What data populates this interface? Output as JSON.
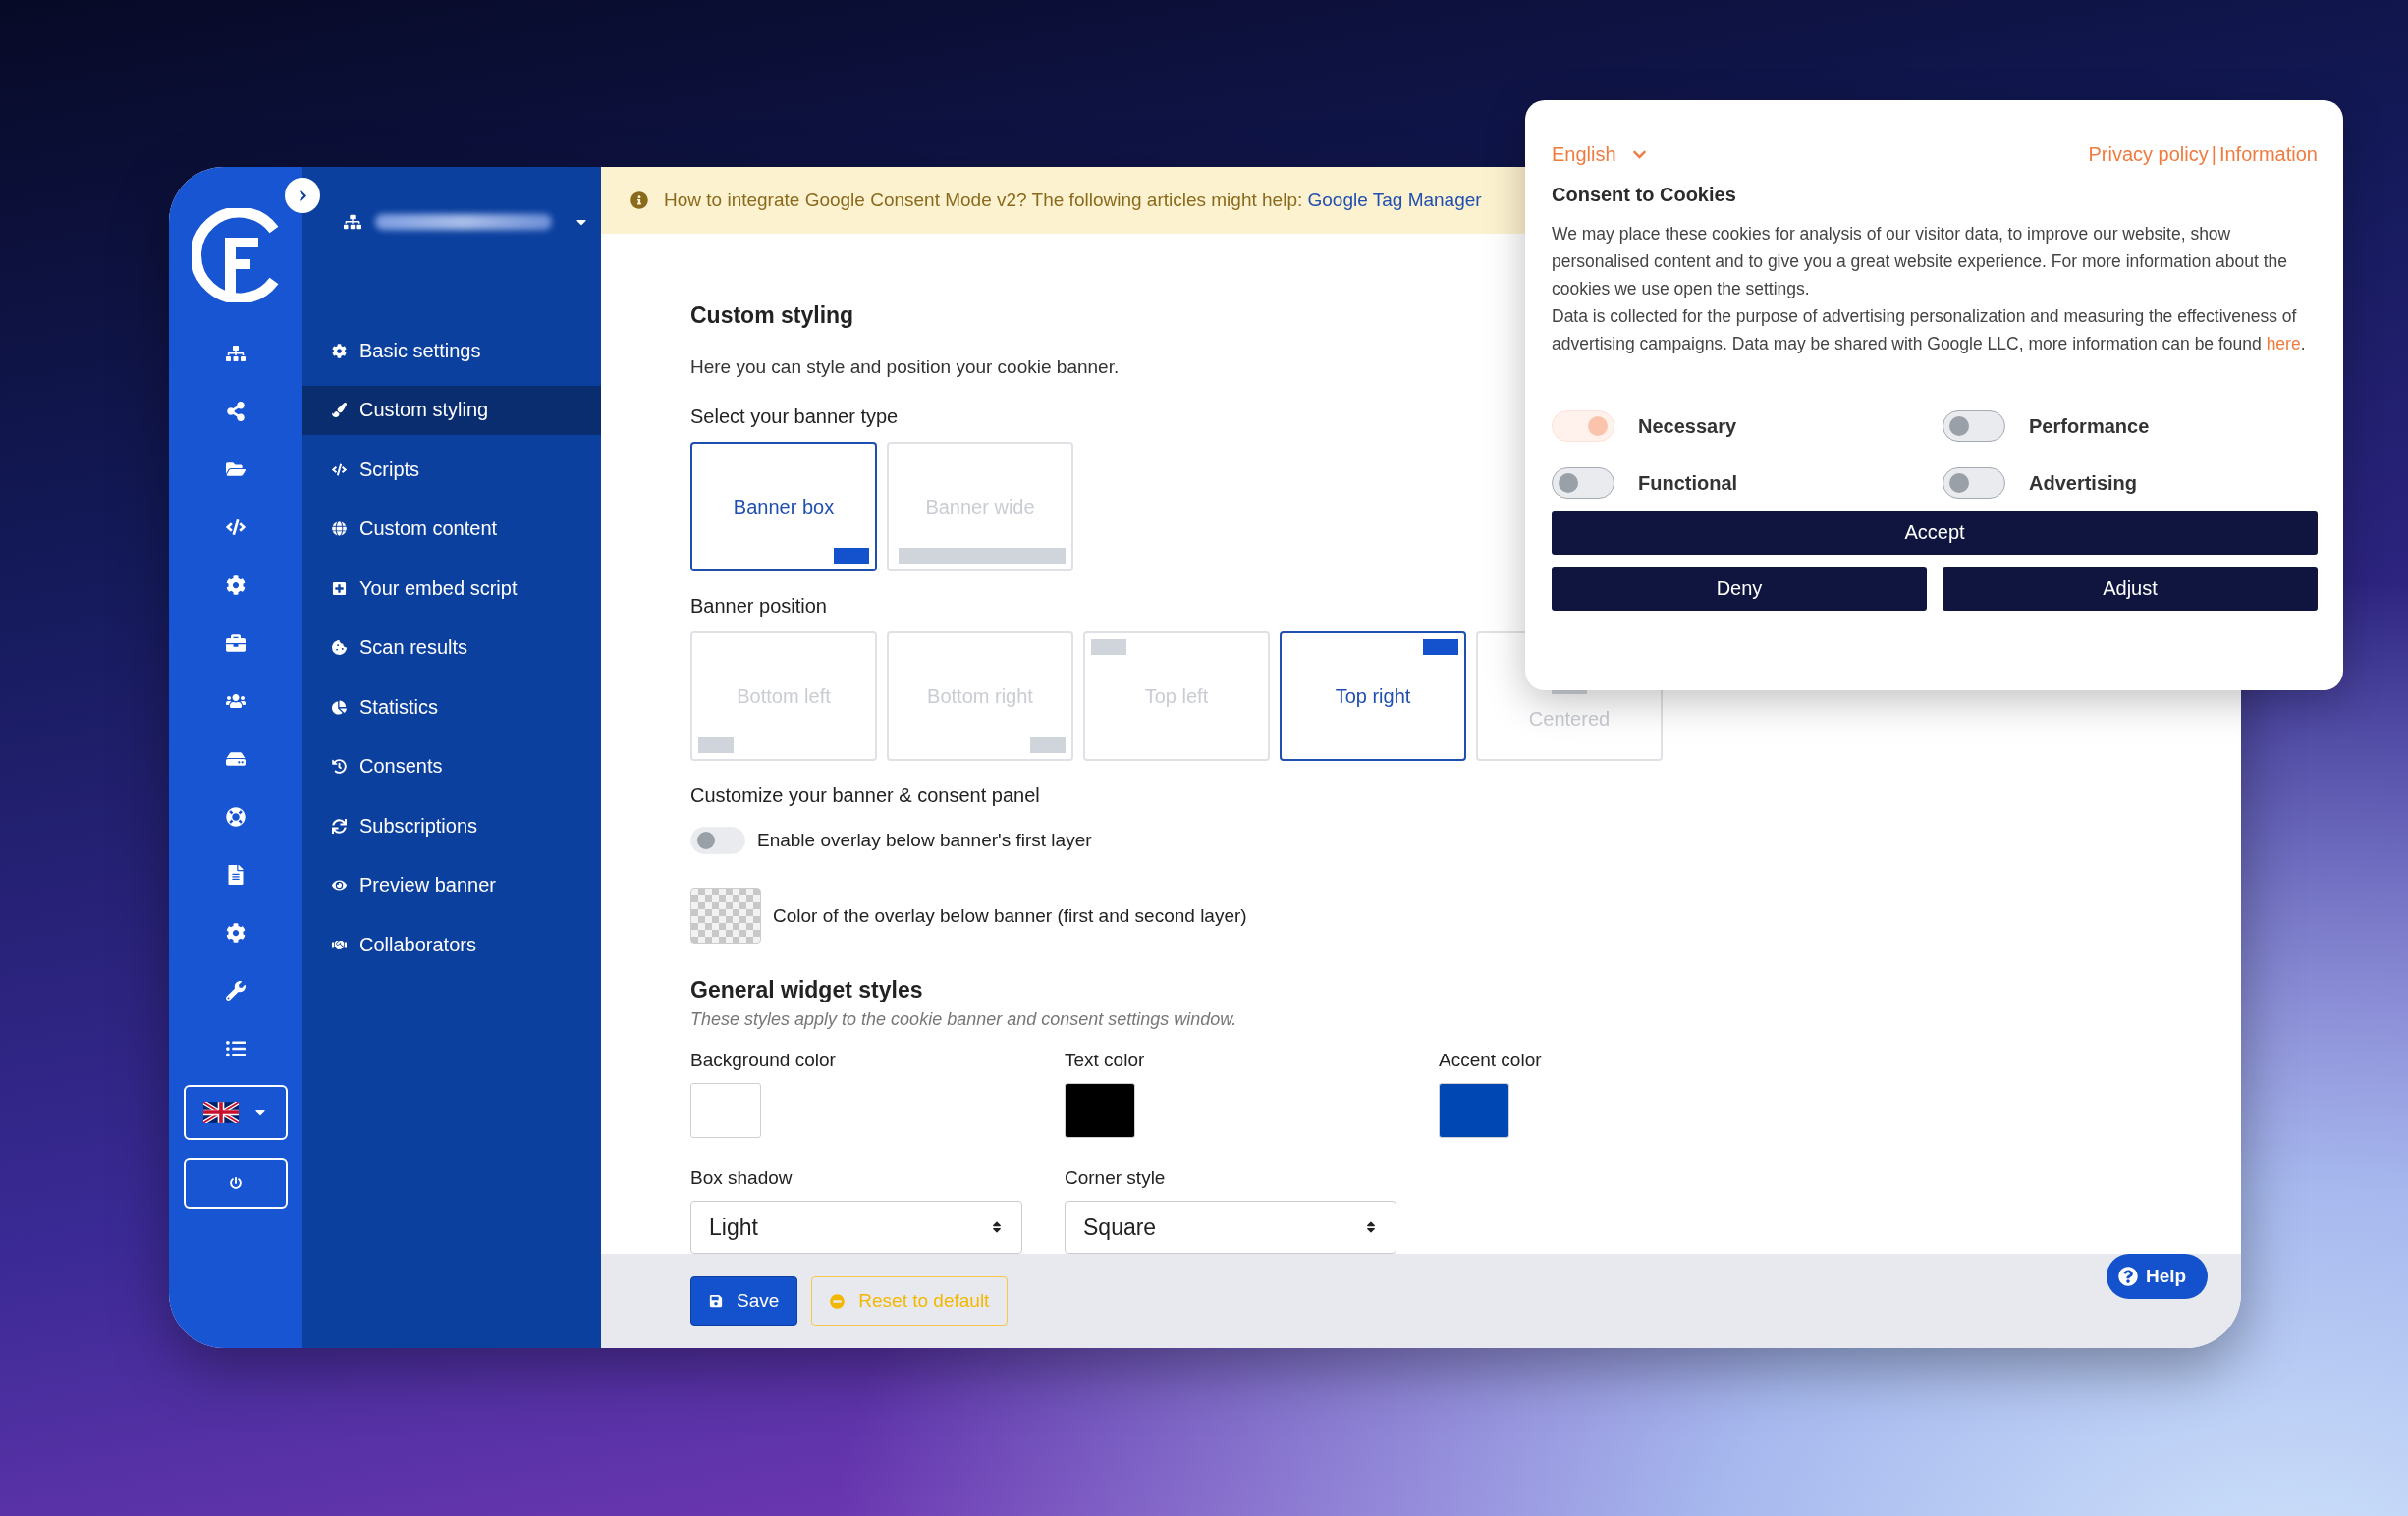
{
  "nav": {
    "items": [
      {
        "label": "Basic settings",
        "selected": false
      },
      {
        "label": "Custom styling",
        "selected": true
      },
      {
        "label": "Scripts",
        "selected": false
      },
      {
        "label": "Custom content",
        "selected": false
      },
      {
        "label": "Your embed script",
        "selected": false
      },
      {
        "label": "Scan results",
        "selected": false
      },
      {
        "label": "Statistics",
        "selected": false
      },
      {
        "label": "Consents",
        "selected": false
      },
      {
        "label": "Subscriptions",
        "selected": false
      },
      {
        "label": "Preview banner",
        "selected": false
      },
      {
        "label": "Collaborators",
        "selected": false
      }
    ]
  },
  "notice": {
    "text": "How to integrate Google Consent Mode v2? The following articles might help:",
    "link": "Google Tag Manager"
  },
  "page": {
    "title": "Custom styling",
    "description": "Here you can style and position your cookie banner."
  },
  "banner_type": {
    "label": "Select your banner type",
    "options": [
      {
        "label": "Banner box",
        "kind": "box",
        "selected": true
      },
      {
        "label": "Banner wide",
        "kind": "wide",
        "selected": false
      }
    ]
  },
  "banner_position": {
    "label": "Banner position",
    "options": [
      {
        "label": "Bottom left",
        "kind": "bottom-left",
        "selected": false
      },
      {
        "label": "Bottom right",
        "kind": "bottom-right",
        "selected": false
      },
      {
        "label": "Top left",
        "kind": "top-left",
        "selected": false
      },
      {
        "label": "Top right",
        "kind": "top-right",
        "selected": true
      },
      {
        "label": "Centered",
        "kind": "centered",
        "selected": false
      }
    ]
  },
  "customize": {
    "label": "Customize your banner & consent panel",
    "overlay_toggle": {
      "label": "Enable overlay below banner's first layer",
      "on": false
    },
    "overlay_color": {
      "label": "Color of the overlay below banner (first and second layer)"
    }
  },
  "widget_styles": {
    "title": "General widget styles",
    "subtitle": "These styles apply to the cookie banner and consent settings window.",
    "colors": [
      {
        "label": "Background color",
        "color": "#ffffff"
      },
      {
        "label": "Text color",
        "color": "#000000"
      },
      {
        "label": "Accent color",
        "color": "#0047b3"
      }
    ],
    "selects": [
      {
        "label": "Box shadow",
        "value": "Light"
      },
      {
        "label": "Corner style",
        "value": "Square"
      }
    ]
  },
  "footer": {
    "save": "Save",
    "reset": "Reset to default"
  },
  "help": "Help",
  "popup": {
    "language": "English",
    "links": [
      "Privacy policy",
      "Information"
    ],
    "separator": "|",
    "title": "Consent to Cookies",
    "paragraph_1": "We may place these cookies for analysis of our visitor data, to improve our website, show personalised content and to give you a great website experience. For more information about the cookies we use open the settings.",
    "paragraph_2": {
      "text": "Data is collected for the purpose of advertising personalization and measuring the effectiveness of advertising campaigns. Data may be shared with Google LLC, more information can be found ",
      "link": "here",
      "end": "."
    },
    "toggles": [
      {
        "label": "Necessary",
        "on": true,
        "disabled": true
      },
      {
        "label": "Performance",
        "on": false,
        "disabled": false
      },
      {
        "label": "Functional",
        "on": false,
        "disabled": false
      },
      {
        "label": "Advertising",
        "on": false,
        "disabled": false
      }
    ],
    "accept": "Accept",
    "deny": "Deny",
    "adjust": "Adjust"
  }
}
